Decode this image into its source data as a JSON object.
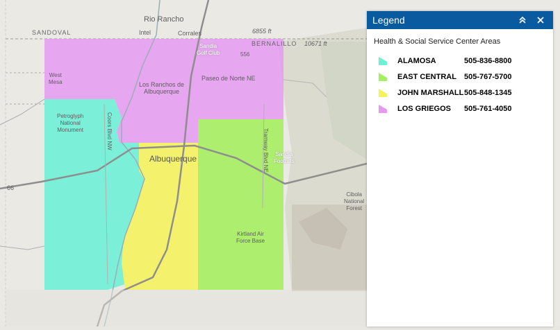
{
  "map": {
    "labels": {
      "rio_rancho": "Rio Rancho",
      "sandoval": "SANDOVAL",
      "intel": "Intel",
      "corrales": "Corrales",
      "elev_6855": "6855 ft",
      "bernalillo": "BERNALILLO",
      "elev_10671": "10671 ft",
      "sandia_golf": "Sandia\nGolf Club",
      "ssb": "556",
      "west_mesa": "West\nMesa",
      "paseo": "Paseo de Norte NE",
      "los_ranchos": "Los Ranchos de\nAlbuquerque",
      "petroglyph": "Petroglyph\nNational\nMonument",
      "coors": "Coors Blvd NW",
      "tramway": "Tramway Blvd NE",
      "albuquerque": "Albuquerque",
      "sandia_foothills": "Sandia\nFoothills",
      "cibola": "Cibola\nNational\nForest",
      "kirtland": "Kirtland Air\nForce Base",
      "i66": "66"
    }
  },
  "legend": {
    "title": "Legend",
    "collapse_icon": "double-chevron-up-icon",
    "close_icon": "close-icon",
    "layer_title": "Health & Social Service Center Areas",
    "items": [
      {
        "name": "ALAMOSA",
        "phone": "505-836-8800",
        "color": "#6ff0d6"
      },
      {
        "name": "EAST CENTRAL",
        "phone": "505-767-5700",
        "color": "#a6ee62"
      },
      {
        "name": "JOHN MARSHALL",
        "phone": "505-848-1345",
        "color": "#f5f25e"
      },
      {
        "name": "LOS GRIEGOS",
        "phone": "505-761-4050",
        "color": "#e59af2"
      }
    ]
  },
  "colors": {
    "header": "#0a5aa0",
    "alamosa": "#6ff0d6",
    "east_central": "#a6ee62",
    "john_marshall": "#f5f25e",
    "los_griegos": "#e59af2",
    "base": "#e9e7e2",
    "mountain": "#d9d6c8",
    "forest": "#d3d7c5"
  }
}
